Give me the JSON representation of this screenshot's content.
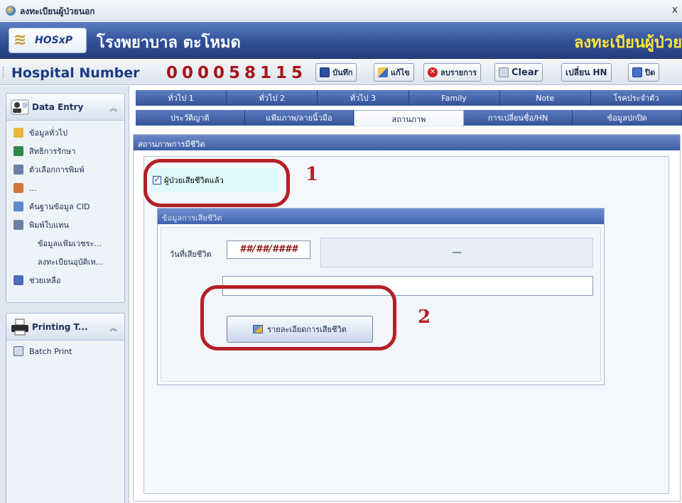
{
  "window": {
    "title": "ลงทะเบียนผู้ป่วยนอก",
    "close_glyph": "x"
  },
  "banner": {
    "logo_text": "HOSxP",
    "hospital_name": "โรงพยาบาล ตะโหมด",
    "module_title": "ลงทะเบียนผู้ป่วย"
  },
  "toolbar": {
    "hn_label": "Hospital Number",
    "hn_value": "000058115",
    "buttons": {
      "save": "บันทึก",
      "edit": "แก้ไข",
      "delete": "ลบรายการ",
      "clear": "Clear",
      "change_hn": "เปลี่ยน HN",
      "exit": "ปิด"
    }
  },
  "sidebar": {
    "data_entry": {
      "title": "Data Entry",
      "items": [
        {
          "label": "ข้อมูลทั่วไป",
          "icon": "info-icon"
        },
        {
          "label": "สิทธิการรักษา",
          "icon": "rights-icon"
        },
        {
          "label": "ตัวเลือกการพิมพ์",
          "icon": "print-options-icon"
        },
        {
          "label": "...",
          "icon": "people-icon"
        },
        {
          "label": "ค้นฐานข้อมูล CID",
          "icon": "search-cid-icon"
        },
        {
          "label": "พิมพ์ใบแทน",
          "icon": "print-icon"
        },
        {
          "label": "ข้อมูลแฟ้มเวชระ...",
          "icon": ""
        },
        {
          "label": "ลงทะเบียนอุบัติเห...",
          "icon": ""
        },
        {
          "label": "ช่วยเหลือ",
          "icon": "help-icon"
        }
      ]
    },
    "printing": {
      "title": "Printing T...",
      "items": [
        {
          "label": "Batch Print",
          "icon": "batch-print-icon"
        }
      ]
    }
  },
  "tabs": {
    "row1": [
      "ทั่วไป 1",
      "ทั่วไป 2",
      "ทั่วไป 3",
      "Family",
      "Note",
      "โรคประจำตัว"
    ],
    "row2": [
      "ประวัติญาติ",
      "แฟ้มภาพ/ลายนิ้วมือ",
      "สถานภาพ",
      "การเปลี่ยนชื่อ/HN",
      "ข้อมูลปกปิด"
    ],
    "active": "สถานภาพ"
  },
  "status_panel": {
    "group_title": "สถานภาพการมีชีวิต",
    "deceased_checkbox_label": "ผู้ป่วยเสียชีวิตแล้ว",
    "deceased_checked": true,
    "death_group_title": "ข้อมูลการเสียชีวิต",
    "death_date_label": "วันที่เสียชีวิต",
    "death_date_value": "##/##/####",
    "age_display": "—",
    "detail_button": "รายละเอียดการเสียชีวิต"
  },
  "annotations": {
    "one": "1",
    "two": "2"
  },
  "colors": {
    "banner": "#2f4f98",
    "hn_value": "#a4161a",
    "module_title": "#ffe63b",
    "annotation": "#b51f26"
  }
}
